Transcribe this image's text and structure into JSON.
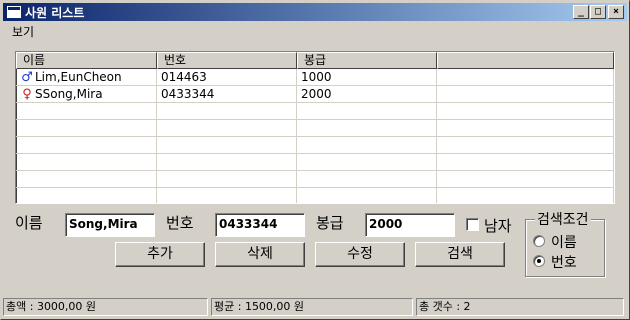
{
  "window": {
    "title": "사원 리스트"
  },
  "titlebar_buttons": {
    "minimize": "_",
    "maximize": "□",
    "close": "×"
  },
  "menu": [
    "보기"
  ],
  "list": {
    "columns": [
      "이름",
      "번호",
      "봉급",
      ""
    ],
    "rows": [
      {
        "gender": "male",
        "gender_icon": "♂",
        "name": "Lim,EunCheon",
        "number": "014463",
        "salary": "1000"
      },
      {
        "gender": "female",
        "gender_icon": "♀",
        "name": "SSong,Mira",
        "number": "0433344",
        "salary": "2000"
      }
    ]
  },
  "form": {
    "name_label": "이름",
    "name_value": "Song,Mira",
    "number_label": "번호",
    "number_value": "0433344",
    "salary_label": "봉급",
    "salary_value": "2000",
    "male_label": "남자",
    "male_checked": false
  },
  "buttons": {
    "add": "추가",
    "delete": "삭제",
    "edit": "수정",
    "search": "검색"
  },
  "search_group": {
    "legend": "검색조건",
    "options": [
      {
        "label": "이름",
        "checked": false
      },
      {
        "label": "번호",
        "checked": true
      }
    ]
  },
  "status": {
    "total": "총액 : 3000,00 원",
    "average": "평균 : 1500,00 원",
    "count": "총 갯수 : 2"
  },
  "colors": {
    "male_icon": "#1e3cc8",
    "female_icon": "#c81e1e",
    "titlebar_start": "#0a246a"
  }
}
